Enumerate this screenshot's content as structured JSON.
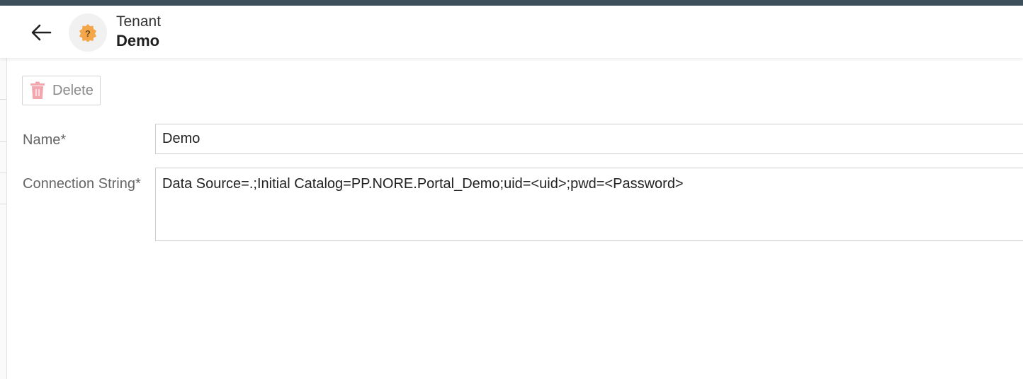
{
  "header": {
    "entity_type": "Tenant",
    "entity_name": "Demo",
    "back_icon": "arrow-left-icon",
    "avatar_icon": "question-badge-icon",
    "avatar_color": "#f4a64a"
  },
  "toolbar": {
    "delete_label": "Delete",
    "delete_icon": "trash-icon",
    "delete_icon_color": "#f2a6ad"
  },
  "form": {
    "name_label": "Name*",
    "name_value": "Demo",
    "connection_label": "Connection String*",
    "connection_value": "Data Source=.;Initial Catalog=PP.NORE.Portal_Demo;uid=<uid>;pwd=<Password>"
  },
  "colors": {
    "top_strip": "#3d4f5a"
  }
}
